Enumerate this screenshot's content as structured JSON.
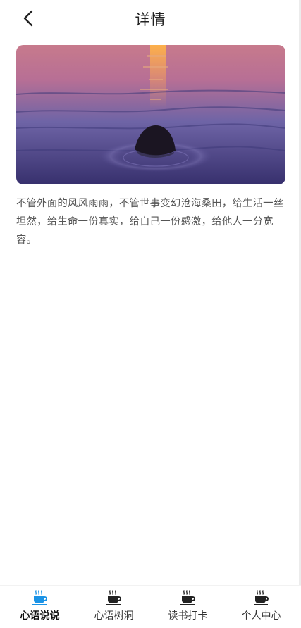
{
  "header": {
    "title": "详情",
    "back_icon": "chevron-left-icon"
  },
  "hero": {
    "description_icon": "sunset-sea-rock-photo"
  },
  "content": {
    "text": "不管外面的风风雨雨，不管世事变幻沧海桑田，给生活一丝坦然，给生命一份真实，给自己一份感激，给他人一分宽容。"
  },
  "tabbar": {
    "tabs": [
      {
        "label": "心语说说",
        "icon": "coffee-cup-icon",
        "active": true
      },
      {
        "label": "心语树洞",
        "icon": "coffee-cup-icon",
        "active": false
      },
      {
        "label": "读书打卡",
        "icon": "coffee-cup-icon",
        "active": false
      },
      {
        "label": "个人中心",
        "icon": "coffee-cup-icon",
        "active": false
      }
    ]
  },
  "colors": {
    "active_tab": "#1a93e6",
    "inactive_tab": "#222222"
  }
}
